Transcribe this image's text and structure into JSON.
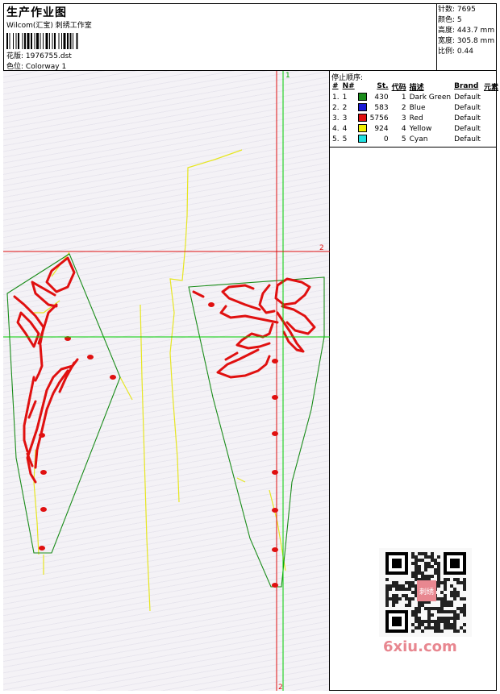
{
  "header": {
    "title": "生产作业图",
    "company": "Wilcom(汇宝) 刺绣工作室",
    "design_label": "花版:",
    "design_value": "1976755.dst",
    "color_label": "色位:",
    "color_value": "Colorway 1"
  },
  "info": {
    "stitches_label": "针数:",
    "stitches_value": "7695",
    "colors_label": "颜色:",
    "colors_value": "5",
    "height_label": "高度:",
    "height_value": "443.7 mm",
    "width_label": "宽度:",
    "width_value": "305.8 mm",
    "scale_label": "比例:",
    "scale_value": "0.44"
  },
  "stop_sequence": {
    "title": "停止顺序:",
    "columns": [
      "#",
      "N#",
      "St.",
      "代码",
      "描述",
      "Brand",
      "元素"
    ],
    "rows": [
      {
        "idx": "1.",
        "n": "1",
        "color": "#1a8c1a",
        "st": "430",
        "code": "1",
        "desc": "Dark Green",
        "brand": "Default"
      },
      {
        "idx": "2.",
        "n": "2",
        "color": "#1a1ad6",
        "st": "583",
        "code": "2",
        "desc": "Blue",
        "brand": "Default"
      },
      {
        "idx": "3.",
        "n": "3",
        "color": "#e01010",
        "st": "5756",
        "code": "3",
        "desc": "Red",
        "brand": "Default"
      },
      {
        "idx": "4.",
        "n": "4",
        "color": "#f0f000",
        "st": "924",
        "code": "4",
        "desc": "Yellow",
        "brand": "Default"
      },
      {
        "idx": "5.",
        "n": "5",
        "color": "#20e0e0",
        "st": "0",
        "code": "5",
        "desc": "Cyan",
        "brand": "Default"
      }
    ]
  },
  "canvas": {
    "axis_v_label": "1",
    "axis_h_label": "2",
    "axis_bottom_label": "2"
  },
  "watermark": {
    "text": "6xiu.com",
    "seal_text": "刺绣"
  },
  "colors": {
    "green": "#1a8c1a",
    "red": "#e01010",
    "yellow": "#e6e620",
    "guide_green": "#00cc00"
  }
}
